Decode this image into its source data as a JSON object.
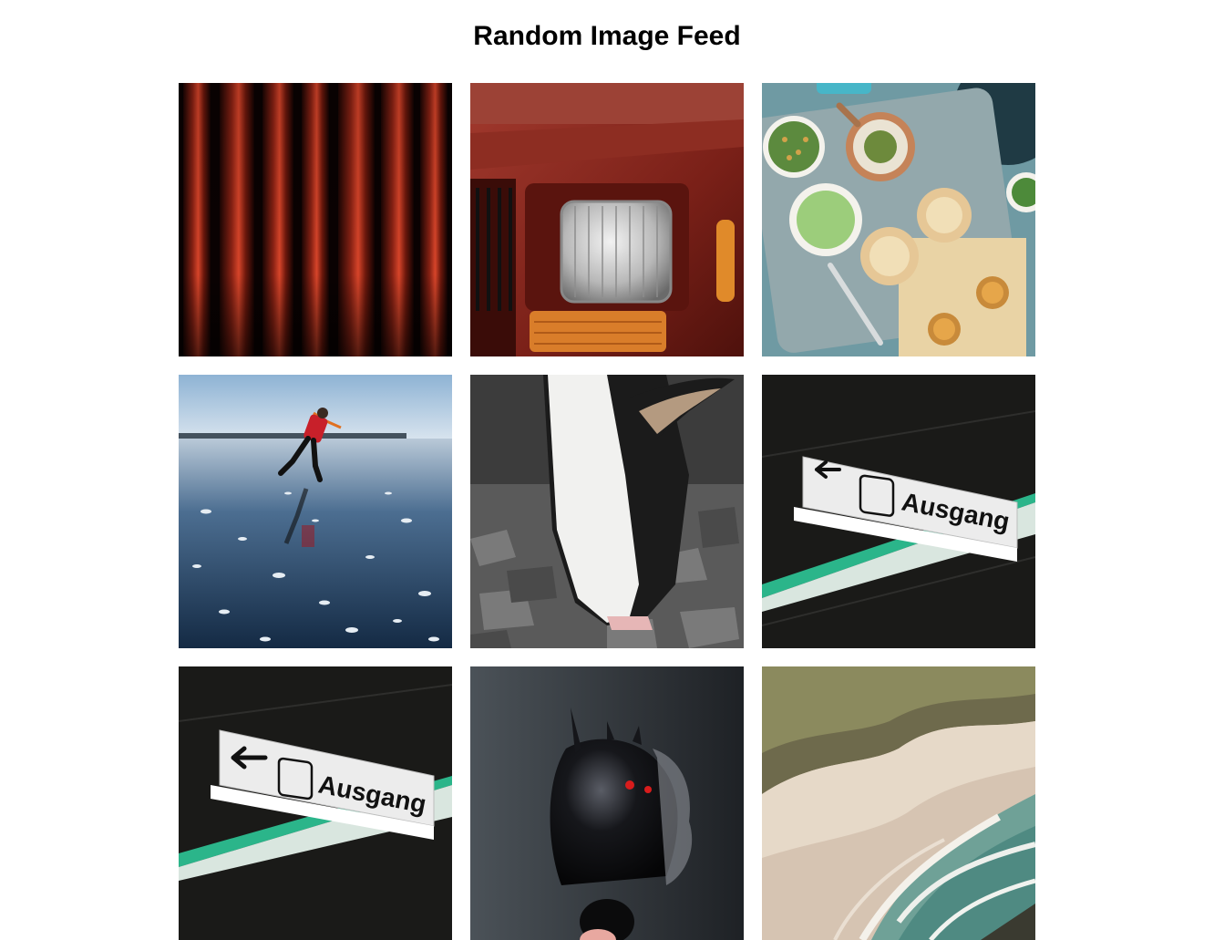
{
  "page": {
    "title": "Random Image Feed"
  },
  "feed": {
    "items": [
      {
        "subject": "red-curtain"
      },
      {
        "subject": "red-car-headlight"
      },
      {
        "subject": "food-tray"
      },
      {
        "subject": "ice-skater"
      },
      {
        "subject": "penguin"
      },
      {
        "subject": "exit-sign",
        "sign_text": "Ausgang"
      },
      {
        "subject": "exit-sign",
        "sign_text": "Ausgang"
      },
      {
        "subject": "black-sculpture"
      },
      {
        "subject": "aerial-coast"
      }
    ]
  },
  "colors": {
    "background": "#ffffff",
    "title": "#000000"
  }
}
